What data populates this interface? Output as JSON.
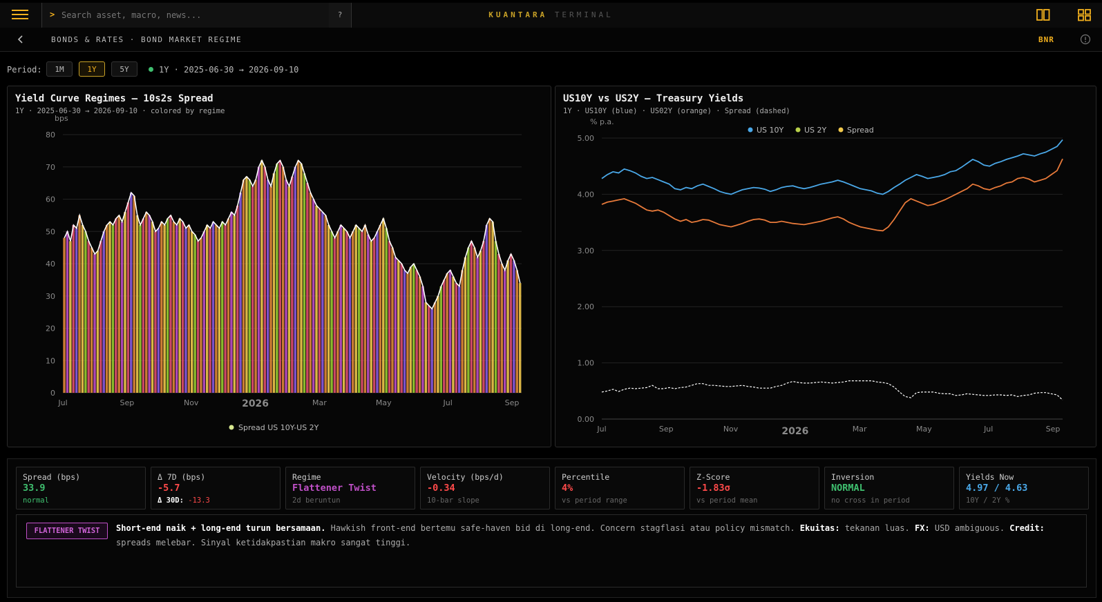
{
  "app": {
    "brand_primary": "KUANTARA",
    "brand_secondary": "TERMINAL",
    "search_placeholder": "Search asset, macro, news...",
    "search_prompt": ">",
    "help_label": "?"
  },
  "breadcrumb": {
    "text": "BONDS & RATES · BOND MARKET REGIME",
    "code": "BNR"
  },
  "period": {
    "label": "Period:",
    "options": [
      "1M",
      "1Y",
      "5Y"
    ],
    "selected": "1Y",
    "range_text": "1Y · 2025-06-30 → 2026-09-10"
  },
  "colors": {
    "accent": "#f2b01e",
    "us10y": "#4aa8e8",
    "us2y": "#e87a3a",
    "spread": "#ffffff",
    "positive": "#3fbf6f",
    "negative": "#ff4a4a",
    "regime": "#c050c8"
  },
  "chart_data": [
    {
      "type": "bar",
      "title": "Yield Curve Regimes — 10s2s Spread",
      "subtitle": "1Y · 2025-06-30 → 2026-09-10 · colored by regime",
      "ylabel": "bps",
      "ylim": [
        0,
        80
      ],
      "yticks": [
        "0",
        "10",
        "20",
        "30",
        "40",
        "50",
        "60",
        "70",
        "80"
      ],
      "xticks": [
        "Jul",
        "Sep",
        "Nov",
        "2026",
        "Mar",
        "May",
        "Jul",
        "Sep"
      ],
      "legend": "Spread US 10Y-US 2Y",
      "regime_colors": [
        "#e08a3a",
        "#c050c8",
        "#f2c94c",
        "#9acd32",
        "#e05070",
        "#8a5ce0"
      ],
      "values": [
        48,
        50,
        47,
        52,
        51,
        55,
        52,
        50,
        47,
        45,
        43,
        44,
        47,
        50,
        52,
        53,
        52,
        54,
        55,
        53,
        56,
        59,
        62,
        61,
        55,
        52,
        54,
        56,
        55,
        53,
        50,
        51,
        53,
        52,
        54,
        55,
        53,
        52,
        54,
        53,
        51,
        52,
        50,
        49,
        47,
        48,
        50,
        52,
        51,
        53,
        52,
        51,
        53,
        52,
        54,
        56,
        55,
        58,
        62,
        66,
        67,
        66,
        64,
        66,
        70,
        72,
        70,
        66,
        64,
        68,
        71,
        72,
        70,
        66,
        64,
        67,
        70,
        72,
        71,
        68,
        65,
        62,
        60,
        58,
        57,
        56,
        55,
        52,
        50,
        48,
        50,
        52,
        51,
        50,
        48,
        50,
        52,
        51,
        50,
        52,
        49,
        47,
        48,
        50,
        52,
        54,
        51,
        47,
        45,
        42,
        41,
        40,
        38,
        37,
        39,
        40,
        38,
        36,
        33,
        28,
        27,
        26,
        28,
        30,
        33,
        35,
        37,
        38,
        36,
        34,
        33,
        38,
        42,
        45,
        47,
        45,
        42,
        44,
        47,
        52,
        54,
        53,
        47,
        43,
        40,
        38,
        41,
        43,
        41,
        38,
        34
      ]
    },
    {
      "type": "line",
      "title": "US10Y vs US2Y — Treasury Yields",
      "subtitle": "1Y · US10Y (blue) · US02Y (orange) · Spread (dashed)",
      "ylabel": "% p.a.",
      "ylim": [
        0,
        5
      ],
      "yticks": [
        "0.00",
        "1.00",
        "2.00",
        "3.00",
        "4.00",
        "5.00"
      ],
      "xticks": [
        "Jul",
        "Sep",
        "Nov",
        "2026",
        "Mar",
        "May",
        "Jul",
        "Sep"
      ],
      "series": [
        {
          "name": "US 10Y",
          "values": [
            4.28,
            4.35,
            4.4,
            4.38,
            4.45,
            4.42,
            4.38,
            4.32,
            4.28,
            4.3,
            4.26,
            4.22,
            4.18,
            4.1,
            4.08,
            4.12,
            4.1,
            4.15,
            4.18,
            4.14,
            4.1,
            4.05,
            4.02,
            4.0,
            4.04,
            4.08,
            4.1,
            4.12,
            4.11,
            4.09,
            4.05,
            4.08,
            4.12,
            4.14,
            4.15,
            4.12,
            4.1,
            4.12,
            4.15,
            4.18,
            4.2,
            4.22,
            4.25,
            4.22,
            4.18,
            4.14,
            4.1,
            4.08,
            4.06,
            4.02,
            4.0,
            4.05,
            4.12,
            4.18,
            4.25,
            4.3,
            4.35,
            4.32,
            4.28,
            4.3,
            4.32,
            4.35,
            4.4,
            4.42,
            4.48,
            4.55,
            4.62,
            4.58,
            4.52,
            4.5,
            4.55,
            4.58,
            4.62,
            4.65,
            4.68,
            4.72,
            4.7,
            4.68,
            4.72,
            4.75,
            4.8,
            4.85,
            4.97
          ]
        },
        {
          "name": "US 2Y",
          "values": [
            3.82,
            3.86,
            3.88,
            3.9,
            3.92,
            3.88,
            3.84,
            3.78,
            3.72,
            3.7,
            3.72,
            3.68,
            3.62,
            3.56,
            3.52,
            3.55,
            3.5,
            3.52,
            3.55,
            3.54,
            3.5,
            3.46,
            3.44,
            3.42,
            3.45,
            3.48,
            3.52,
            3.55,
            3.56,
            3.54,
            3.5,
            3.5,
            3.52,
            3.5,
            3.48,
            3.47,
            3.46,
            3.48,
            3.5,
            3.52,
            3.55,
            3.58,
            3.6,
            3.56,
            3.5,
            3.46,
            3.42,
            3.4,
            3.38,
            3.36,
            3.35,
            3.42,
            3.55,
            3.7,
            3.85,
            3.92,
            3.88,
            3.84,
            3.8,
            3.82,
            3.86,
            3.9,
            3.95,
            4.0,
            4.05,
            4.1,
            4.18,
            4.15,
            4.1,
            4.08,
            4.12,
            4.15,
            4.2,
            4.22,
            4.28,
            4.3,
            4.27,
            4.22,
            4.25,
            4.28,
            4.35,
            4.42,
            4.63
          ]
        },
        {
          "name": "Spread",
          "values": [
            0.48,
            0.5,
            0.53,
            0.49,
            0.53,
            0.55,
            0.54,
            0.55,
            0.56,
            0.6,
            0.54,
            0.54,
            0.56,
            0.54,
            0.56,
            0.57,
            0.6,
            0.63,
            0.63,
            0.6,
            0.6,
            0.59,
            0.58,
            0.58,
            0.59,
            0.6,
            0.58,
            0.57,
            0.55,
            0.55,
            0.55,
            0.58,
            0.6,
            0.64,
            0.67,
            0.65,
            0.64,
            0.64,
            0.65,
            0.66,
            0.65,
            0.64,
            0.65,
            0.66,
            0.68,
            0.68,
            0.68,
            0.68,
            0.68,
            0.66,
            0.65,
            0.63,
            0.57,
            0.48,
            0.4,
            0.38,
            0.47,
            0.48,
            0.48,
            0.48,
            0.46,
            0.45,
            0.45,
            0.42,
            0.43,
            0.45,
            0.44,
            0.43,
            0.42,
            0.42,
            0.43,
            0.43,
            0.42,
            0.43,
            0.4,
            0.42,
            0.43,
            0.46,
            0.47,
            0.47,
            0.45,
            0.43,
            0.34
          ]
        }
      ]
    }
  ],
  "stats": [
    {
      "label": "Spread (bps)",
      "value": "33.9",
      "value_color": "#3fbf6f",
      "note": "normal",
      "note_color": "#3fbf6f"
    },
    {
      "label": "Δ 7D (bps)",
      "value": "-5.7",
      "value_color": "#ff4a4a",
      "note_prefix": "Δ 30D:",
      "note": "-13.3",
      "note_color": "#ff4a4a"
    },
    {
      "label": "Regime",
      "value": "Flattener Twist",
      "value_color": "#c050c8",
      "note": "2d beruntun"
    },
    {
      "label": "Velocity (bps/d)",
      "value": "-0.34",
      "value_color": "#ff4a4a",
      "note": "10-bar slope"
    },
    {
      "label": "Percentile",
      "value": "4%",
      "value_color": "#ff4a4a",
      "note": "vs period range"
    },
    {
      "label": "Z-Score",
      "value": "-1.83σ",
      "value_color": "#ff4a4a",
      "note": "vs period mean"
    },
    {
      "label": "Inversion",
      "value": "NORMAL",
      "value_color": "#3fbf6f",
      "note": "no cross in period"
    },
    {
      "label": "Yields Now",
      "value": "4.97 / 4.63",
      "value_color": "#4aa8e8",
      "note": "10Y / 2Y %"
    }
  ],
  "regime_detail": {
    "badge": "FLATTENER TWIST",
    "headline": "Short-end naik + long-end turun bersamaan.",
    "body": "Hawkish front-end bertemu safe-haven bid di long-end. Concern stagflasi atau policy mismatch.",
    "equities_label": "Ekuitas:",
    "equities_text": "tekanan luas.",
    "fx_label": "FX:",
    "fx_text": "USD ambiguous.",
    "credit_label": "Credit:",
    "credit_text": "spreads melebar. Sinyal ketidakpastian makro sangat tinggi."
  }
}
